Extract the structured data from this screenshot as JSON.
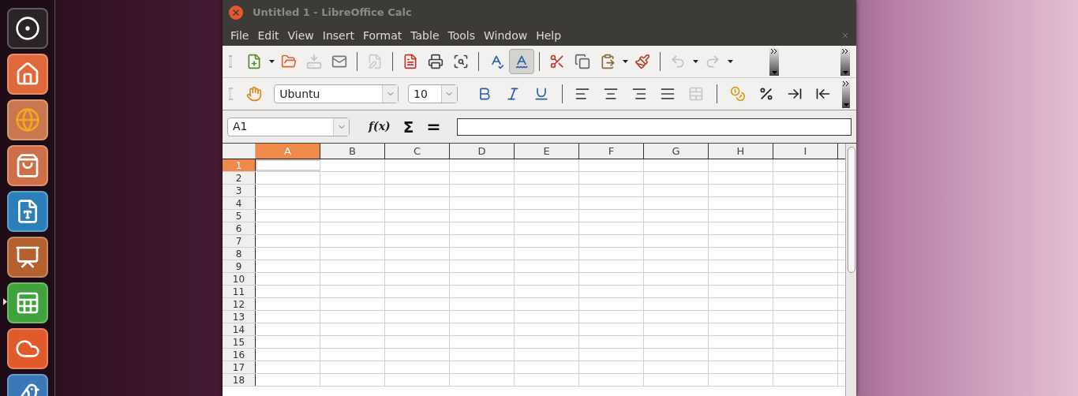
{
  "launcher": [
    {
      "kind": "dash",
      "active": false
    },
    {
      "kind": "home-folder",
      "active": false
    },
    {
      "kind": "browser",
      "active": false
    },
    {
      "kind": "software-center",
      "active": false
    },
    {
      "kind": "writer",
      "active": false
    },
    {
      "kind": "impress",
      "active": false
    },
    {
      "kind": "calc",
      "active": true
    },
    {
      "kind": "ubuntu-one",
      "active": false
    },
    {
      "kind": "mail",
      "active": false
    }
  ],
  "window": {
    "title": "Untitled 1 - LibreOffice Calc"
  },
  "menu": [
    "File",
    "Edit",
    "View",
    "Insert",
    "Format",
    "Table",
    "Tools",
    "Window",
    "Help"
  ],
  "standard_toolbar": [
    {
      "kind": "new",
      "disabled": false,
      "pressed": false,
      "dropdown": true
    },
    {
      "kind": "open",
      "disabled": false,
      "pressed": false
    },
    {
      "kind": "save",
      "disabled": true,
      "pressed": false
    },
    {
      "kind": "email",
      "disabled": false,
      "pressed": false
    },
    {
      "kind": "sep"
    },
    {
      "kind": "edit-file",
      "disabled": true,
      "pressed": false
    },
    {
      "kind": "sep"
    },
    {
      "kind": "pdf",
      "disabled": false,
      "pressed": false
    },
    {
      "kind": "print",
      "disabled": false,
      "pressed": false
    },
    {
      "kind": "preview",
      "disabled": false,
      "pressed": false
    },
    {
      "kind": "sep"
    },
    {
      "kind": "spellcheck",
      "disabled": false,
      "pressed": false
    },
    {
      "kind": "autospell",
      "disabled": false,
      "pressed": true
    },
    {
      "kind": "sep"
    },
    {
      "kind": "cut",
      "disabled": false,
      "pressed": false
    },
    {
      "kind": "copy",
      "disabled": false,
      "pressed": false
    },
    {
      "kind": "paste",
      "disabled": false,
      "pressed": false,
      "dropdown": true
    },
    {
      "kind": "clone",
      "disabled": false,
      "pressed": false
    },
    {
      "kind": "sep"
    },
    {
      "kind": "undo",
      "disabled": true,
      "pressed": false,
      "dropdown": true
    },
    {
      "kind": "redo",
      "disabled": true,
      "pressed": false,
      "dropdown": true
    }
  ],
  "formatting_toolbar": {
    "font_name": "Ubuntu",
    "font_size": "10",
    "items": [
      {
        "kind": "bold",
        "disabled": false
      },
      {
        "kind": "italic",
        "disabled": false
      },
      {
        "kind": "underline",
        "disabled": false
      },
      {
        "kind": "sep"
      },
      {
        "kind": "align-left",
        "disabled": false
      },
      {
        "kind": "align-center",
        "disabled": false
      },
      {
        "kind": "align-right",
        "disabled": false
      },
      {
        "kind": "justify",
        "disabled": false
      },
      {
        "kind": "merge",
        "disabled": true
      },
      {
        "kind": "sep"
      },
      {
        "kind": "currency",
        "disabled": false
      },
      {
        "kind": "percent",
        "disabled": false
      },
      {
        "kind": "add-decimal",
        "disabled": false
      },
      {
        "kind": "delete-decimal",
        "disabled": false
      }
    ]
  },
  "formula_bar": {
    "name_box": "A1",
    "function_symbol": "f(x)",
    "sum_symbol": "Σ",
    "equals_symbol": "="
  },
  "sheet": {
    "columns": [
      {
        "label": "A",
        "selected": true
      },
      {
        "label": "B",
        "selected": false
      },
      {
        "label": "C",
        "selected": false
      },
      {
        "label": "D",
        "selected": false
      },
      {
        "label": "E",
        "selected": false
      },
      {
        "label": "F",
        "selected": false
      },
      {
        "label": "G",
        "selected": false
      },
      {
        "label": "H",
        "selected": false
      },
      {
        "label": "I",
        "selected": false
      }
    ],
    "rows": [
      {
        "label": "1",
        "selected": true
      },
      {
        "label": "2",
        "selected": false
      },
      {
        "label": "3",
        "selected": false
      },
      {
        "label": "4",
        "selected": false
      },
      {
        "label": "5",
        "selected": false
      },
      {
        "label": "6",
        "selected": false
      },
      {
        "label": "7",
        "selected": false
      },
      {
        "label": "8",
        "selected": false
      },
      {
        "label": "9",
        "selected": false
      },
      {
        "label": "10",
        "selected": false
      },
      {
        "label": "11",
        "selected": false
      },
      {
        "label": "12",
        "selected": false
      },
      {
        "label": "13",
        "selected": false
      },
      {
        "label": "14",
        "selected": false
      },
      {
        "label": "15",
        "selected": false
      },
      {
        "label": "16",
        "selected": false
      },
      {
        "label": "17",
        "selected": false
      },
      {
        "label": "18",
        "selected": false
      }
    ]
  }
}
